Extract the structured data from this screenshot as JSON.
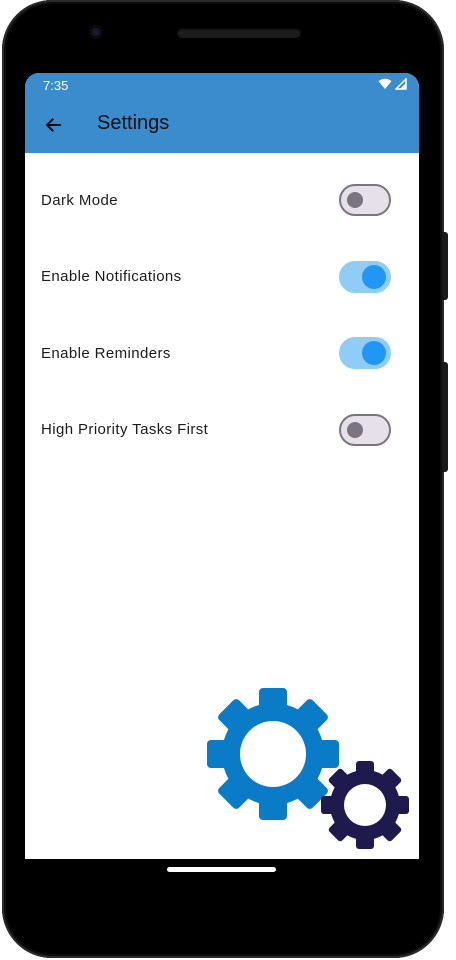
{
  "status_bar": {
    "time": "7:35",
    "icons": [
      "wifi-icon",
      "cell-signal-icon"
    ]
  },
  "app_bar": {
    "title": "Settings",
    "back_icon": "arrow-back-icon",
    "background": "#3a8ccd"
  },
  "settings": [
    {
      "label": "Dark Mode",
      "enabled": false
    },
    {
      "label": "Enable Notifications",
      "enabled": true
    },
    {
      "label": "Enable Reminders",
      "enabled": true
    },
    {
      "label": "High Priority Tasks First",
      "enabled": false
    }
  ],
  "illustration": {
    "icon": "gears-icon",
    "large_gear_color": "#0a7bc6",
    "small_gear_color": "#1f1a4e"
  },
  "colors": {
    "switch_on_track": "#8fcdf7",
    "switch_on_thumb": "#2196f3",
    "switch_off_track": "#e6e1e8",
    "switch_off_thumb": "#79747e"
  }
}
